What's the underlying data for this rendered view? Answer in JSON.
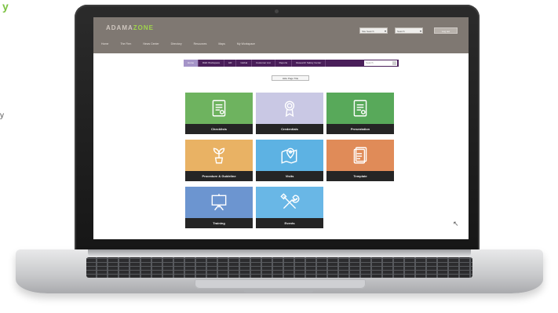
{
  "edge_marks": {
    "green": "y",
    "dark": "y"
  },
  "header": {
    "logo_prefix": "ADAMA",
    "logo_accent": "ZONE",
    "select_1": "Site Search",
    "select_2": "Search",
    "button": "Log out",
    "nav": [
      "Home",
      "The Firm",
      "News Center",
      "Directory",
      "Resources",
      "Maps",
      "My Workspace"
    ]
  },
  "subnav": {
    "items": [
      "Home",
      "R&D Workspace",
      "HR",
      "Global",
      "Customer List",
      "Reports",
      "Research Safety Center"
    ],
    "search_placeholder": "Search"
  },
  "hide_button": "Hide Page Title",
  "tiles": [
    {
      "label": "Checklists",
      "icon": "document-icon",
      "color": "#6eb35f"
    },
    {
      "label": "Credentials",
      "icon": "medal-icon",
      "color": "#c9c8e4"
    },
    {
      "label": "Presentation",
      "icon": "document-icon",
      "color": "#58a95a"
    },
    {
      "label": "Procedure & Guideline",
      "icon": "plant-icon",
      "color": "#e9b264"
    },
    {
      "label": "Visits",
      "icon": "map-pin-icon",
      "color": "#5db2e3"
    },
    {
      "label": "Template",
      "icon": "template-icon",
      "color": "#e08b58"
    },
    {
      "label": "Training",
      "icon": "presentation-board-icon",
      "color": "#6c95d0"
    },
    {
      "label": "Events",
      "icon": "tools-icon",
      "color": "#69b7e6"
    }
  ]
}
